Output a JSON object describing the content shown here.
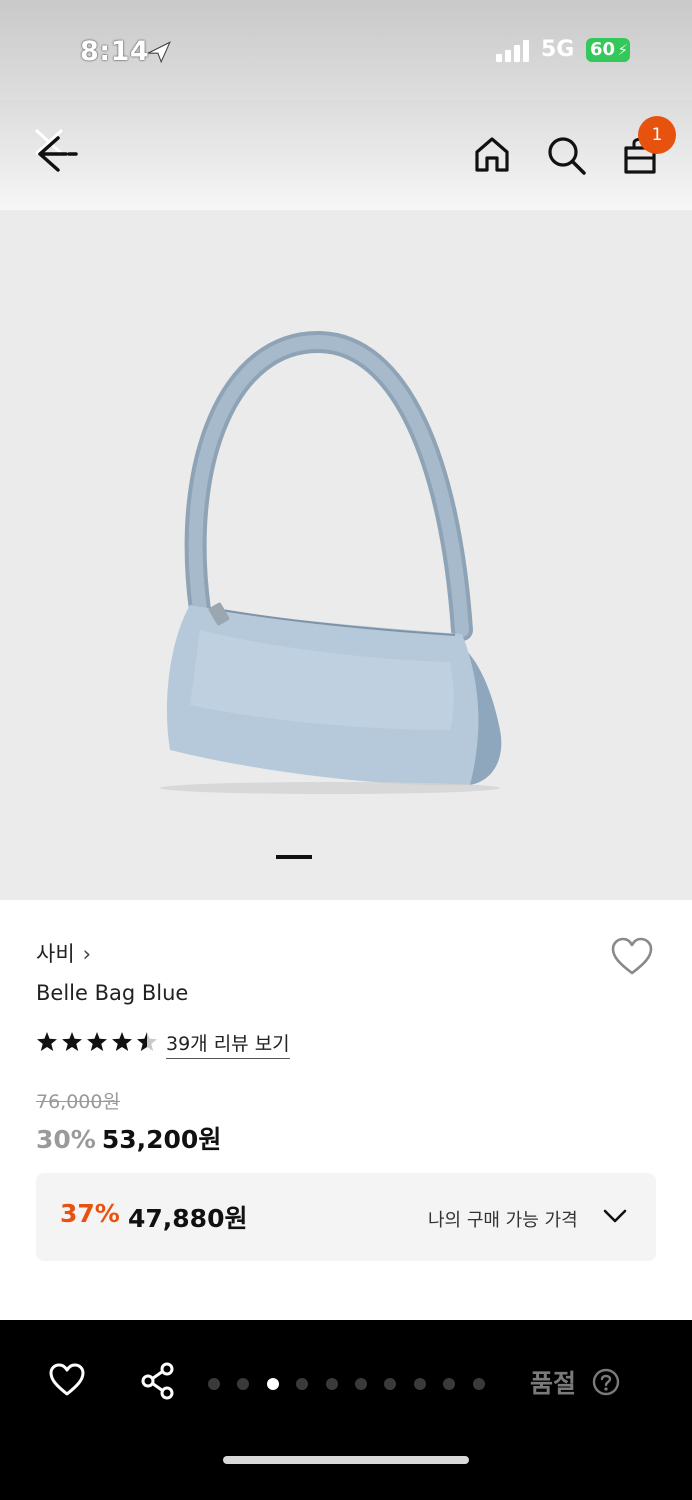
{
  "status_bar": {
    "time": "8:14",
    "network": "5G",
    "battery": "60"
  },
  "nav": {
    "cart_count": "1"
  },
  "product": {
    "brand": "사비",
    "brand_chevron": "›",
    "name": "Belle Bag Blue",
    "rating": 4.5,
    "review_link": "39개 리뷰 보기",
    "original_price": "76,000원",
    "discount_rate": "30%",
    "sale_price": "53,200원",
    "my_discount_rate": "37%",
    "my_price": "47,880원",
    "my_price_label": "나의 구매 가능 가격"
  },
  "image_carousel": {
    "indicator_count": 1,
    "active_index": 0
  },
  "bottom_bar": {
    "page_dots_count": 10,
    "active_dot_index": 2,
    "soldout_label": "품절"
  },
  "colors": {
    "accent": "#e8520f",
    "badge": "#e8520f",
    "battery": "#34c759",
    "image_background": "#ebebeb",
    "bag_blue": "#a9bfd3"
  },
  "icons": [
    "back-icon",
    "home-icon",
    "search-icon",
    "shopping-bag-icon",
    "heart-icon",
    "star-icon",
    "chevron-down-icon",
    "share-icon",
    "help-icon"
  ]
}
